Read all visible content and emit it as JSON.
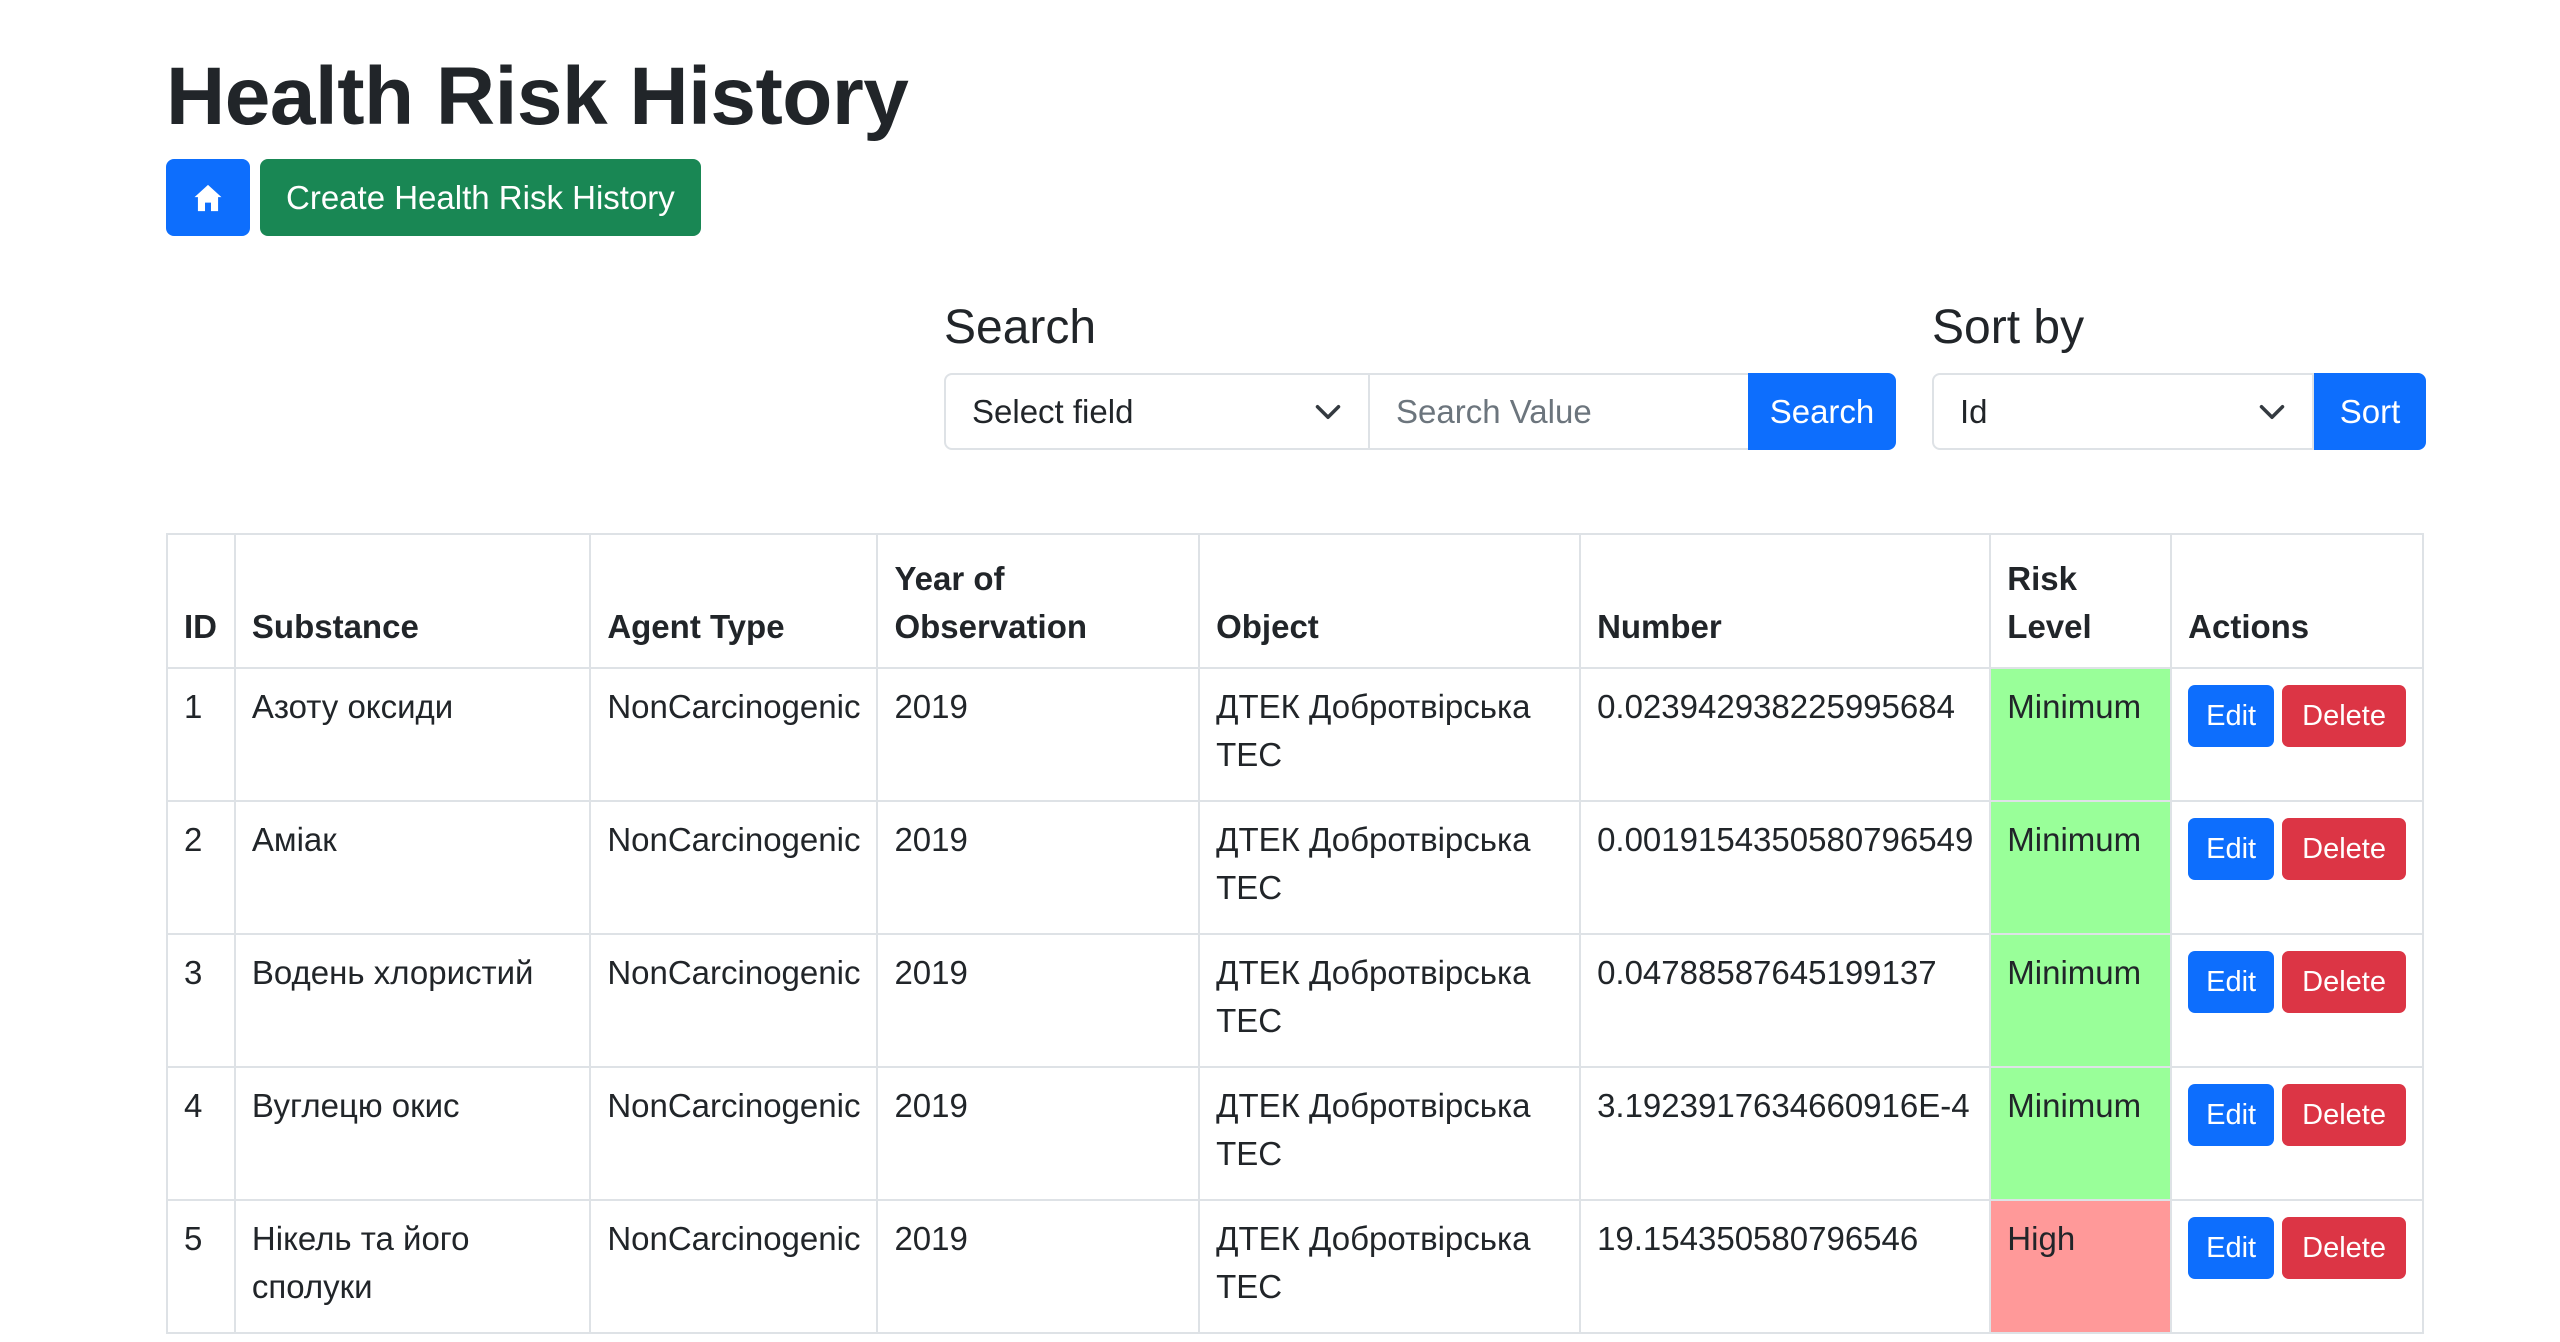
{
  "page": {
    "title": "Health Risk History"
  },
  "toolbar": {
    "home_icon": "home-icon",
    "create_label": "Create Health Risk History"
  },
  "search": {
    "label": "Search",
    "field_select": "Select field",
    "value_placeholder": "Search Value",
    "button": "Search"
  },
  "sort": {
    "label": "Sort by",
    "selected": "Id",
    "button": "Sort"
  },
  "table": {
    "headers": [
      "ID",
      "Substance",
      "Agent Type",
      "Year of Observation",
      "Object",
      "Number",
      "Risk Level",
      "Actions"
    ],
    "rows": [
      {
        "id": "1",
        "substance": "Азоту оксиди",
        "agent_type": "NonCarcinogenic",
        "year": "2019",
        "object": "ДТЕК Добротвірська ТЕС",
        "number": "0.023942938225995684",
        "risk": "Minimum"
      },
      {
        "id": "2",
        "substance": "Аміак",
        "agent_type": "NonCarcinogenic",
        "year": "2019",
        "object": "ДТЕК Добротвірська ТЕС",
        "number": "0.0019154350580796549",
        "risk": "Minimum"
      },
      {
        "id": "3",
        "substance": "Водень хлористий",
        "agent_type": "NonCarcinogenic",
        "year": "2019",
        "object": "ДТЕК Добротвірська ТЕС",
        "number": "0.04788587645199137",
        "risk": "Minimum"
      },
      {
        "id": "4",
        "substance": "Вуглецю окис",
        "agent_type": "NonCarcinogenic",
        "year": "2019",
        "object": "ДТЕК Добротвірська ТЕС",
        "number": "3.1923917634660916E-4",
        "risk": "Minimum"
      },
      {
        "id": "5",
        "substance": "Нікель та його сполуки",
        "agent_type": "NonCarcinogenic",
        "year": "2019",
        "object": "ДТЕК Добротвірська ТЕС",
        "number": "19.154350580796546",
        "risk": "High"
      }
    ],
    "edit_label": "Edit",
    "delete_label": "Delete"
  },
  "colors": {
    "primary": "#0d6efd",
    "success": "#198754",
    "danger": "#dc3545",
    "risk_minimum": "#99ff99",
    "risk_high": "#ff9999"
  }
}
